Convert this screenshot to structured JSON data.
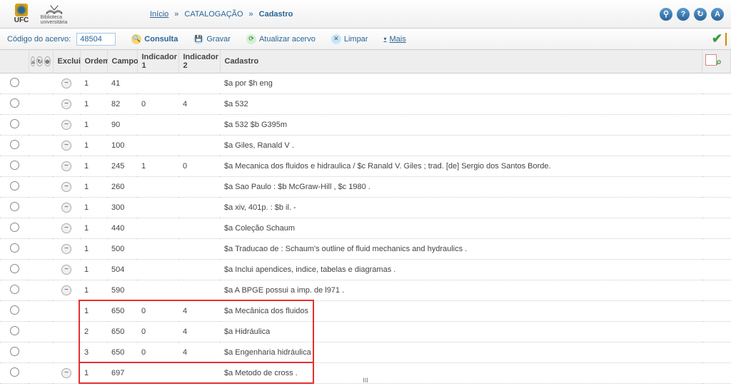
{
  "header": {
    "logo_ufc": "UFC",
    "logo_lib": "Biblioteca universitária",
    "breadcrumb": {
      "inicio": "Início",
      "catalogacao": "CATALOGAÇÃO",
      "cadastro": "Cadastro",
      "sep": "»"
    },
    "icons": [
      "globe-icon",
      "help-icon",
      "refresh-icon",
      "letter-a-icon"
    ]
  },
  "toolbar": {
    "codigo_label": "Código do acervo:",
    "codigo_value": "48504",
    "consulta": "Consulta",
    "gravar": "Gravar",
    "atualizar": "Atualizar acervo",
    "limpar": "Limpar",
    "mais": "Mais"
  },
  "columns": {
    "excluir": "Excluir",
    "ordem": "Ordem",
    "campo": "Campo",
    "ind1": "Indicador 1",
    "ind2": "Indicador 2",
    "cadastro": "Cadastro"
  },
  "rows": [
    {
      "excl": true,
      "ordem": "1",
      "campo": "41",
      "ind1": "",
      "ind2": "",
      "cad": "$a por $h eng"
    },
    {
      "excl": true,
      "ordem": "1",
      "campo": "82",
      "ind1": "0",
      "ind2": "4",
      "cad": "$a 532"
    },
    {
      "excl": true,
      "ordem": "1",
      "campo": "90",
      "ind1": "",
      "ind2": "",
      "cad": "$a 532 $b G395m"
    },
    {
      "excl": true,
      "ordem": "1",
      "campo": "100",
      "ind1": "",
      "ind2": "",
      "cad": "$a Giles, Ranald V ."
    },
    {
      "excl": true,
      "ordem": "1",
      "campo": "245",
      "ind1": "1",
      "ind2": "0",
      "cad": "$a Mecanica dos fluidos e hidraulica / $c Ranald V. Giles ; trad. [de] Sergio dos Santos Borde."
    },
    {
      "excl": true,
      "ordem": "1",
      "campo": "260",
      "ind1": "",
      "ind2": "",
      "cad": "$a Sao Paulo : $b McGraw-Hill , $c 1980 ."
    },
    {
      "excl": true,
      "ordem": "1",
      "campo": "300",
      "ind1": "",
      "ind2": "",
      "cad": "$a xiv, 401p. : $b il. -"
    },
    {
      "excl": true,
      "ordem": "1",
      "campo": "440",
      "ind1": "",
      "ind2": "",
      "cad": "$a Coleção Schaum"
    },
    {
      "excl": true,
      "ordem": "1",
      "campo": "500",
      "ind1": "",
      "ind2": "",
      "cad": "$a Traducao de : Schaum's outline of fluid mechanics and hydraulics ."
    },
    {
      "excl": true,
      "ordem": "1",
      "campo": "504",
      "ind1": "",
      "ind2": "",
      "cad": "$a Inclui apendices, indice, tabelas e diagramas ."
    },
    {
      "excl": true,
      "ordem": "1",
      "campo": "590",
      "ind1": "",
      "ind2": "",
      "cad": "$a A BPGE possui a imp. de l971 ."
    },
    {
      "excl": false,
      "ordem": "1",
      "campo": "650",
      "ind1": "0",
      "ind2": "4",
      "cad": "$a Mecânica dos fluidos"
    },
    {
      "excl": false,
      "ordem": "2",
      "campo": "650",
      "ind1": "0",
      "ind2": "4",
      "cad": "$a Hidráulica"
    },
    {
      "excl": false,
      "ordem": "3",
      "campo": "650",
      "ind1": "0",
      "ind2": "4",
      "cad": "$a Engenharia hidráulica"
    },
    {
      "excl": true,
      "ordem": "1",
      "campo": "697",
      "ind1": "",
      "ind2": "",
      "cad": "$a Metodo de cross ."
    }
  ],
  "scroll_hint": "III",
  "colors": {
    "accent": "#2a6496",
    "highlight": "#e53030"
  }
}
